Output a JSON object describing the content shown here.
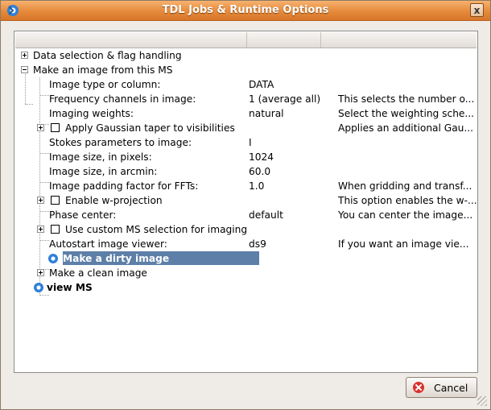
{
  "window": {
    "title": "TDL Jobs & Runtime Options",
    "close_label": "x"
  },
  "tree": {
    "top": {
      "data_selection": "Data selection & flag handling",
      "make_image": "Make an image from this MS",
      "view_ms": "view MS"
    },
    "rows": [
      {
        "label": "Image type or column:",
        "value": "DATA",
        "desc": ""
      },
      {
        "label": "Frequency channels in image:",
        "value": "1 (average all)",
        "desc": "This selects the number o..."
      },
      {
        "label": "Imaging weights:",
        "value": "natural",
        "desc": "Select the weighting sche..."
      },
      {
        "label": "Apply Gaussian taper to visibilities",
        "value": "",
        "desc": "Applies an additional Gau..."
      },
      {
        "label": "Stokes parameters to image:",
        "value": "I",
        "desc": ""
      },
      {
        "label": "Image size, in pixels:",
        "value": "1024",
        "desc": ""
      },
      {
        "label": "Image size, in arcmin:",
        "value": "60.0",
        "desc": ""
      },
      {
        "label": "Image padding factor for FFTs:",
        "value": "1.0",
        "desc": "When gridding and transf..."
      },
      {
        "label": "Enable w-projection",
        "value": "",
        "desc": "This option enables the w-..."
      },
      {
        "label": "Phase center:",
        "value": "default",
        "desc": "You can center the image..."
      },
      {
        "label": "Use custom MS selection for imaging",
        "value": "",
        "desc": ""
      },
      {
        "label": "Autostart image viewer:",
        "value": "ds9",
        "desc": "If you want an image vie..."
      },
      {
        "label": "Make a dirty image",
        "value": "",
        "desc": ""
      },
      {
        "label": "Make a clean image",
        "value": "",
        "desc": ""
      }
    ]
  },
  "buttons": {
    "cancel": "Cancel"
  },
  "colors": {
    "titlebar": "#e58a3a",
    "selection": "#5d7fa8"
  }
}
